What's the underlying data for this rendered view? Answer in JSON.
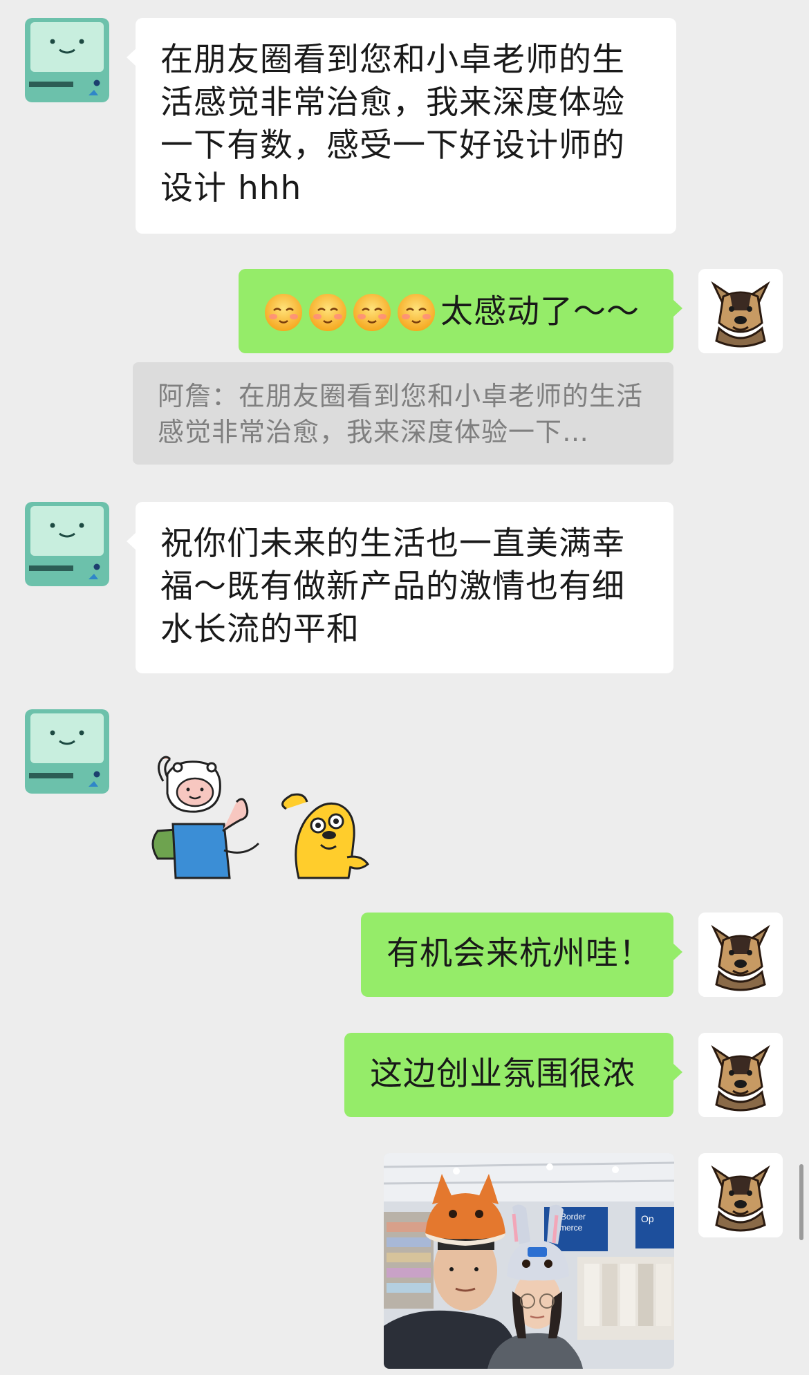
{
  "messages": {
    "m1": {
      "text": "在朋友圈看到您和小卓老师的生活感觉非常治愈，我来深度体验一下有数，感受一下好设计师的设计 hhh"
    },
    "m2": {
      "emoji_count": 4,
      "text": "太感动了～～"
    },
    "m2_quote": {
      "text": "阿詹：在朋友圈看到您和小卓老师的生活感觉非常治愈，我来深度体验一下…"
    },
    "m3": {
      "text": "祝你们未来的生活也一直美满幸福～既有做新产品的激情也有细水长流的平和"
    },
    "m4": {
      "sticker": "finn-and-jake-sticker"
    },
    "m5": {
      "text": "有机会来杭州哇！"
    },
    "m6": {
      "text": "这边创业氛围很浓"
    },
    "m7": {
      "photo": "selfie-photo",
      "sign_text_1": "Border",
      "sign_text_2": "mmerce",
      "sign_text_3": "Op"
    }
  },
  "avatars": {
    "other": "bmo-avatar-icon",
    "self": "dog-avatar-icon"
  },
  "colors": {
    "background": "#ededed",
    "bubble_self": "#95ec69",
    "bubble_other": "#ffffff",
    "quote_bg": "#dcdcdc",
    "quote_text": "#7f7f7f"
  }
}
